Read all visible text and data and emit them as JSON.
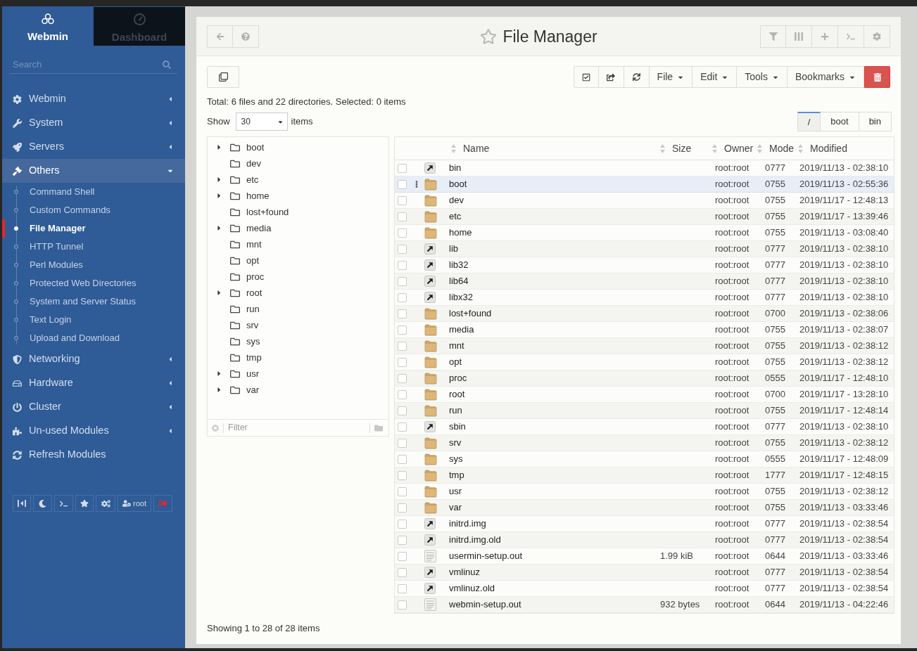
{
  "sidebar": {
    "tabs": [
      {
        "label": "Webmin",
        "selected": true
      },
      {
        "label": "Dashboard",
        "selected": false
      }
    ],
    "search": {
      "placeholder": "Search"
    },
    "menu": [
      {
        "kind": "category",
        "label": "Webmin",
        "expanded": false
      },
      {
        "kind": "category",
        "label": "System",
        "expanded": false
      },
      {
        "kind": "category",
        "label": "Servers",
        "expanded": false
      },
      {
        "kind": "category",
        "label": "Others",
        "expanded": true,
        "children": [
          {
            "label": "Command Shell",
            "selected": false
          },
          {
            "label": "Custom Commands",
            "selected": false
          },
          {
            "label": "File Manager",
            "selected": true
          },
          {
            "label": "HTTP Tunnel",
            "selected": false
          },
          {
            "label": "Perl Modules",
            "selected": false
          },
          {
            "label": "Protected Web Directories",
            "selected": false
          },
          {
            "label": "System and Server Status",
            "selected": false
          },
          {
            "label": "Text Login",
            "selected": false
          },
          {
            "label": "Upload and Download",
            "selected": false
          }
        ]
      },
      {
        "kind": "category",
        "label": "Networking",
        "expanded": false
      },
      {
        "kind": "category",
        "label": "Hardware",
        "expanded": false
      },
      {
        "kind": "category",
        "label": "Cluster",
        "expanded": false
      },
      {
        "kind": "category",
        "label": "Un-used Modules",
        "expanded": false
      },
      {
        "kind": "link",
        "label": "Refresh Modules"
      }
    ],
    "footer": {
      "user": "root"
    }
  },
  "header": {
    "title": "File Manager",
    "starred": false
  },
  "toolbar": {
    "menus": [
      "File",
      "Edit",
      "Tools",
      "Bookmarks"
    ]
  },
  "summary": "Total: 6 files and 22 directories. Selected: 0 items",
  "page_size": {
    "label": "Show",
    "value": "30",
    "suffix": "items"
  },
  "breadcrumbs": [
    {
      "label": "/",
      "selected": true
    },
    {
      "label": "boot",
      "selected": false
    },
    {
      "label": "bin",
      "selected": false
    }
  ],
  "tree": {
    "items": [
      {
        "label": "boot",
        "expandable": true,
        "expanded": false
      },
      {
        "label": "dev",
        "expandable": false,
        "expanded": false
      },
      {
        "label": "etc",
        "expandable": true,
        "expanded": false
      },
      {
        "label": "home",
        "expandable": true,
        "expanded": false
      },
      {
        "label": "lost+found",
        "expandable": false,
        "expanded": false
      },
      {
        "label": "media",
        "expandable": true,
        "expanded": false
      },
      {
        "label": "mnt",
        "expandable": false,
        "expanded": false
      },
      {
        "label": "opt",
        "expandable": false,
        "expanded": false
      },
      {
        "label": "proc",
        "expandable": false,
        "expanded": false
      },
      {
        "label": "root",
        "expandable": true,
        "expanded": false
      },
      {
        "label": "run",
        "expandable": false,
        "expanded": false
      },
      {
        "label": "srv",
        "expandable": false,
        "expanded": false
      },
      {
        "label": "sys",
        "expandable": false,
        "expanded": false
      },
      {
        "label": "tmp",
        "expandable": false,
        "expanded": false
      },
      {
        "label": "usr",
        "expandable": true,
        "expanded": false
      },
      {
        "label": "var",
        "expandable": true,
        "expanded": false
      }
    ],
    "filter": {
      "placeholder": "Filter"
    }
  },
  "table": {
    "columns": [
      "Name",
      "Size",
      "Owner",
      "Mode",
      "Modified"
    ],
    "rows": [
      {
        "kind": "symlink",
        "name": "bin",
        "owner": "root:root",
        "mode": "0777",
        "modified": "2019/11/13 - 02:38:10",
        "checked": false,
        "highlighted": false
      },
      {
        "kind": "folder",
        "name": "boot",
        "owner": "root:root",
        "mode": "0755",
        "modified": "2019/11/13 - 02:55:36",
        "checked": false,
        "highlighted": true
      },
      {
        "kind": "folder",
        "name": "dev",
        "owner": "root:root",
        "mode": "0755",
        "modified": "2019/11/17 - 12:48:13",
        "checked": false,
        "highlighted": false
      },
      {
        "kind": "folder",
        "name": "etc",
        "owner": "root:root",
        "mode": "0755",
        "modified": "2019/11/17 - 13:39:46",
        "checked": false,
        "highlighted": false
      },
      {
        "kind": "folder",
        "name": "home",
        "owner": "root:root",
        "mode": "0755",
        "modified": "2019/11/13 - 03:08:40",
        "checked": false,
        "highlighted": false
      },
      {
        "kind": "symlink",
        "name": "lib",
        "owner": "root:root",
        "mode": "0777",
        "modified": "2019/11/13 - 02:38:10",
        "checked": false,
        "highlighted": false
      },
      {
        "kind": "symlink",
        "name": "lib32",
        "owner": "root:root",
        "mode": "0777",
        "modified": "2019/11/13 - 02:38:10",
        "checked": false,
        "highlighted": false
      },
      {
        "kind": "symlink",
        "name": "lib64",
        "owner": "root:root",
        "mode": "0777",
        "modified": "2019/11/13 - 02:38:10",
        "checked": false,
        "highlighted": false
      },
      {
        "kind": "symlink",
        "name": "libx32",
        "owner": "root:root",
        "mode": "0777",
        "modified": "2019/11/13 - 02:38:10",
        "checked": false,
        "highlighted": false
      },
      {
        "kind": "folder",
        "name": "lost+found",
        "owner": "root:root",
        "mode": "0700",
        "modified": "2019/11/13 - 02:38:06",
        "checked": false,
        "highlighted": false
      },
      {
        "kind": "folder",
        "name": "media",
        "owner": "root:root",
        "mode": "0755",
        "modified": "2019/11/13 - 02:38:07",
        "checked": false,
        "highlighted": false
      },
      {
        "kind": "folder",
        "name": "mnt",
        "owner": "root:root",
        "mode": "0755",
        "modified": "2019/11/13 - 02:38:12",
        "checked": false,
        "highlighted": false
      },
      {
        "kind": "folder",
        "name": "opt",
        "owner": "root:root",
        "mode": "0755",
        "modified": "2019/11/13 - 02:38:12",
        "checked": false,
        "highlighted": false
      },
      {
        "kind": "folder",
        "name": "proc",
        "owner": "root:root",
        "mode": "0555",
        "modified": "2019/11/17 - 12:48:10",
        "checked": false,
        "highlighted": false
      },
      {
        "kind": "folder",
        "name": "root",
        "owner": "root:root",
        "mode": "0700",
        "modified": "2019/11/17 - 13:28:10",
        "checked": false,
        "highlighted": false
      },
      {
        "kind": "folder",
        "name": "run",
        "owner": "root:root",
        "mode": "0755",
        "modified": "2019/11/17 - 12:48:14",
        "checked": false,
        "highlighted": false
      },
      {
        "kind": "symlink",
        "name": "sbin",
        "owner": "root:root",
        "mode": "0777",
        "modified": "2019/11/13 - 02:38:10",
        "checked": false,
        "highlighted": false
      },
      {
        "kind": "folder",
        "name": "srv",
        "owner": "root:root",
        "mode": "0755",
        "modified": "2019/11/13 - 02:38:12",
        "checked": false,
        "highlighted": false
      },
      {
        "kind": "folder",
        "name": "sys",
        "owner": "root:root",
        "mode": "0555",
        "modified": "2019/11/17 - 12:48:09",
        "checked": false,
        "highlighted": false
      },
      {
        "kind": "folder",
        "name": "tmp",
        "owner": "root:root",
        "mode": "1777",
        "modified": "2019/11/17 - 12:48:15",
        "checked": false,
        "highlighted": false
      },
      {
        "kind": "folder",
        "name": "usr",
        "owner": "root:root",
        "mode": "0755",
        "modified": "2019/11/13 - 02:38:12",
        "checked": false,
        "highlighted": false
      },
      {
        "kind": "folder",
        "name": "var",
        "owner": "root:root",
        "mode": "0755",
        "modified": "2019/11/13 - 03:33:46",
        "checked": false,
        "highlighted": false
      },
      {
        "kind": "symlink",
        "name": "initrd.img",
        "owner": "root:root",
        "mode": "0777",
        "modified": "2019/11/13 - 02:38:54",
        "checked": false,
        "highlighted": false
      },
      {
        "kind": "symlink",
        "name": "initrd.img.old",
        "owner": "root:root",
        "mode": "0777",
        "modified": "2019/11/13 - 02:38:54",
        "checked": false,
        "highlighted": false
      },
      {
        "kind": "text",
        "name": "usermin-setup.out",
        "size": "1.99 kiB",
        "owner": "root:root",
        "mode": "0644",
        "modified": "2019/11/13 - 03:33:46",
        "checked": false,
        "highlighted": false
      },
      {
        "kind": "symlink",
        "name": "vmlinuz",
        "owner": "root:root",
        "mode": "0777",
        "modified": "2019/11/13 - 02:38:54",
        "checked": false,
        "highlighted": false
      },
      {
        "kind": "symlink",
        "name": "vmlinuz.old",
        "owner": "root:root",
        "mode": "0777",
        "modified": "2019/11/13 - 02:38:54",
        "checked": false,
        "highlighted": false
      },
      {
        "kind": "text",
        "name": "webmin-setup.out",
        "size": "932 bytes",
        "owner": "root:root",
        "mode": "0644",
        "modified": "2019/11/13 - 04:22:46",
        "checked": false,
        "highlighted": false
      }
    ]
  },
  "footer": "Showing 1 to 28 of 28 items"
}
